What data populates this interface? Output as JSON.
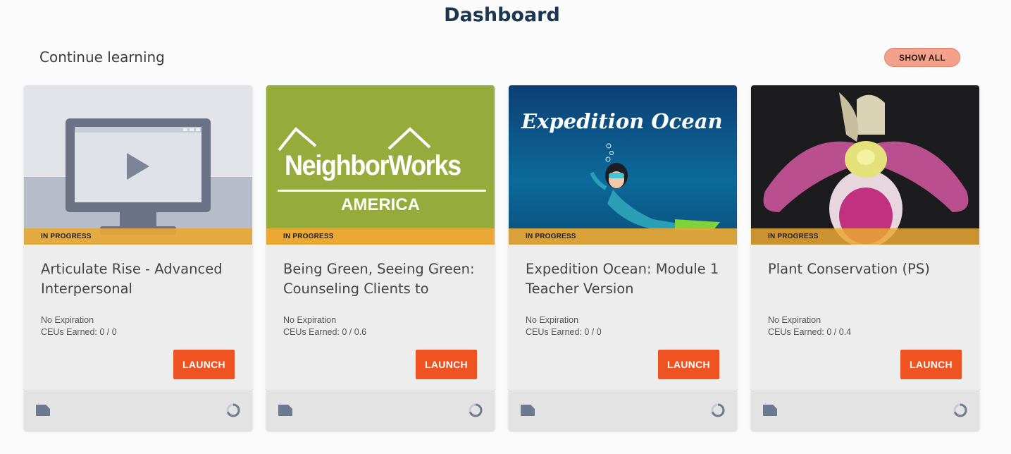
{
  "page": {
    "title": "Dashboard"
  },
  "section": {
    "heading": "Continue learning",
    "show_all_label": "SHOW ALL"
  },
  "cards": [
    {
      "status": "IN PROGRESS",
      "title": "Articulate Rise - Advanced Interpersonal",
      "expiration": "No Expiration",
      "ceus": "CEUs Earned: 0 / 0",
      "launch_label": "LAUNCH",
      "thumbnail": "video-placeholder-icon"
    },
    {
      "status": "IN PROGRESS",
      "title": "Being Green, Seeing Green: Counseling Clients to",
      "expiration": "No Expiration",
      "ceus": "CEUs Earned: 0 / 0.6",
      "launch_label": "LAUNCH",
      "thumbnail": "neighborworks-logo",
      "logo_text": "NeighborWorks",
      "logo_subtext": "AMERICA"
    },
    {
      "status": "IN PROGRESS",
      "title": "Expedition Ocean: Module 1 Teacher Version",
      "expiration": "No Expiration",
      "ceus": "CEUs Earned: 0 / 0",
      "launch_label": "LAUNCH",
      "thumbnail": "expedition-ocean-image",
      "image_text": "Expedition Ocean"
    },
    {
      "status": "IN PROGRESS",
      "title": "Plant Conservation (PS)",
      "expiration": "No Expiration",
      "ceus": "CEUs Earned: 0 / 0.4",
      "launch_label": "LAUNCH",
      "thumbnail": "orchid-photo"
    }
  ],
  "colors": {
    "title": "#1c3550",
    "status_bar": "#eaa834",
    "launch": "#ef5322",
    "show_all": "#f4a18c",
    "footer_icon": "#6b7a90"
  }
}
